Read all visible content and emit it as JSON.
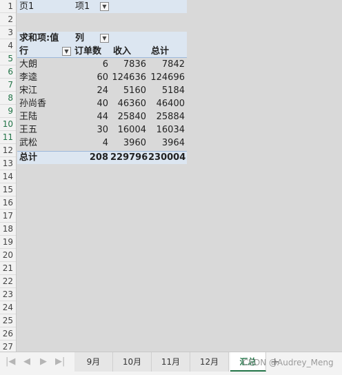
{
  "filter": {
    "label": "页1",
    "value": "项1"
  },
  "pivot": {
    "values_caption": "求和项:值",
    "column_caption": "列",
    "row_caption": "行",
    "col_headers": [
      "订单数",
      "收入",
      "总计"
    ],
    "rows": [
      {
        "name": "大朗",
        "orders": "6",
        "income": "7836",
        "total": "7842"
      },
      {
        "name": "李逵",
        "orders": "60",
        "income": "124636",
        "total": "124696"
      },
      {
        "name": "宋江",
        "orders": "24",
        "income": "5160",
        "total": "5184"
      },
      {
        "name": "孙尚香",
        "orders": "40",
        "income": "46360",
        "total": "46400"
      },
      {
        "name": "王陆",
        "orders": "44",
        "income": "25840",
        "total": "25884"
      },
      {
        "name": "王五",
        "orders": "30",
        "income": "16004",
        "total": "16034"
      },
      {
        "name": "武松",
        "orders": "4",
        "income": "3960",
        "total": "3964"
      }
    ],
    "grand_total": {
      "label": "总计",
      "orders": "208",
      "income": "229796",
      "total": "230004"
    }
  },
  "row_numbers": [
    "1",
    "2",
    "3",
    "4",
    "5",
    "6",
    "7",
    "8",
    "9",
    "10",
    "11",
    "12",
    "13",
    "14",
    "15",
    "16",
    "17",
    "18",
    "19",
    "20",
    "21",
    "22",
    "23",
    "24",
    "25",
    "26",
    "27"
  ],
  "sheet_tabs": [
    "9月",
    "10月",
    "11月",
    "12月",
    "汇总"
  ],
  "active_tab": "汇总",
  "watermark": "CSDN @Audrey_Meng",
  "colors": {
    "accent": "#217346",
    "pivot_shade": "#dce6f1"
  }
}
